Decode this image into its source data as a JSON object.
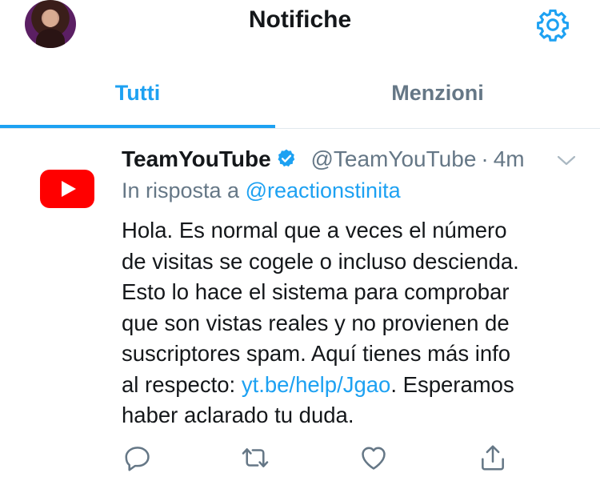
{
  "header": {
    "title": "Notifiche"
  },
  "tabs": [
    {
      "label": "Tutti",
      "active": true
    },
    {
      "label": "Menzioni",
      "active": false
    }
  ],
  "tweet": {
    "author_name": "TeamYouTube",
    "handle": "@TeamYouTube",
    "separator": "·",
    "time": "4m",
    "reply_prefix": "In risposta a",
    "reply_mention": "@reactionstinita",
    "lines": [
      "Hola. Es normal que a veces el número",
      "de visitas se cogele o incluso descienda.",
      "Esto lo hace el sistema para comprobar",
      "que son vistas reales y no provienen de",
      "suscriptores spam. Aquí tienes más info"
    ],
    "line6_before": "al respecto: ",
    "link_text": "yt.be/help/Jgao",
    "line6_after": ". Esperamos",
    "line7": "haber aclarado tu duda."
  },
  "colors": {
    "accent": "#1da1f2",
    "secondary_text": "#657786",
    "youtube_red": "#ff0000"
  },
  "icons": {
    "settings": "gear-icon",
    "verified": "verified-badge-icon",
    "menu": "chevron-down-icon",
    "reply": "reply-icon",
    "retweet": "retweet-icon",
    "like": "heart-icon",
    "share": "share-icon"
  }
}
